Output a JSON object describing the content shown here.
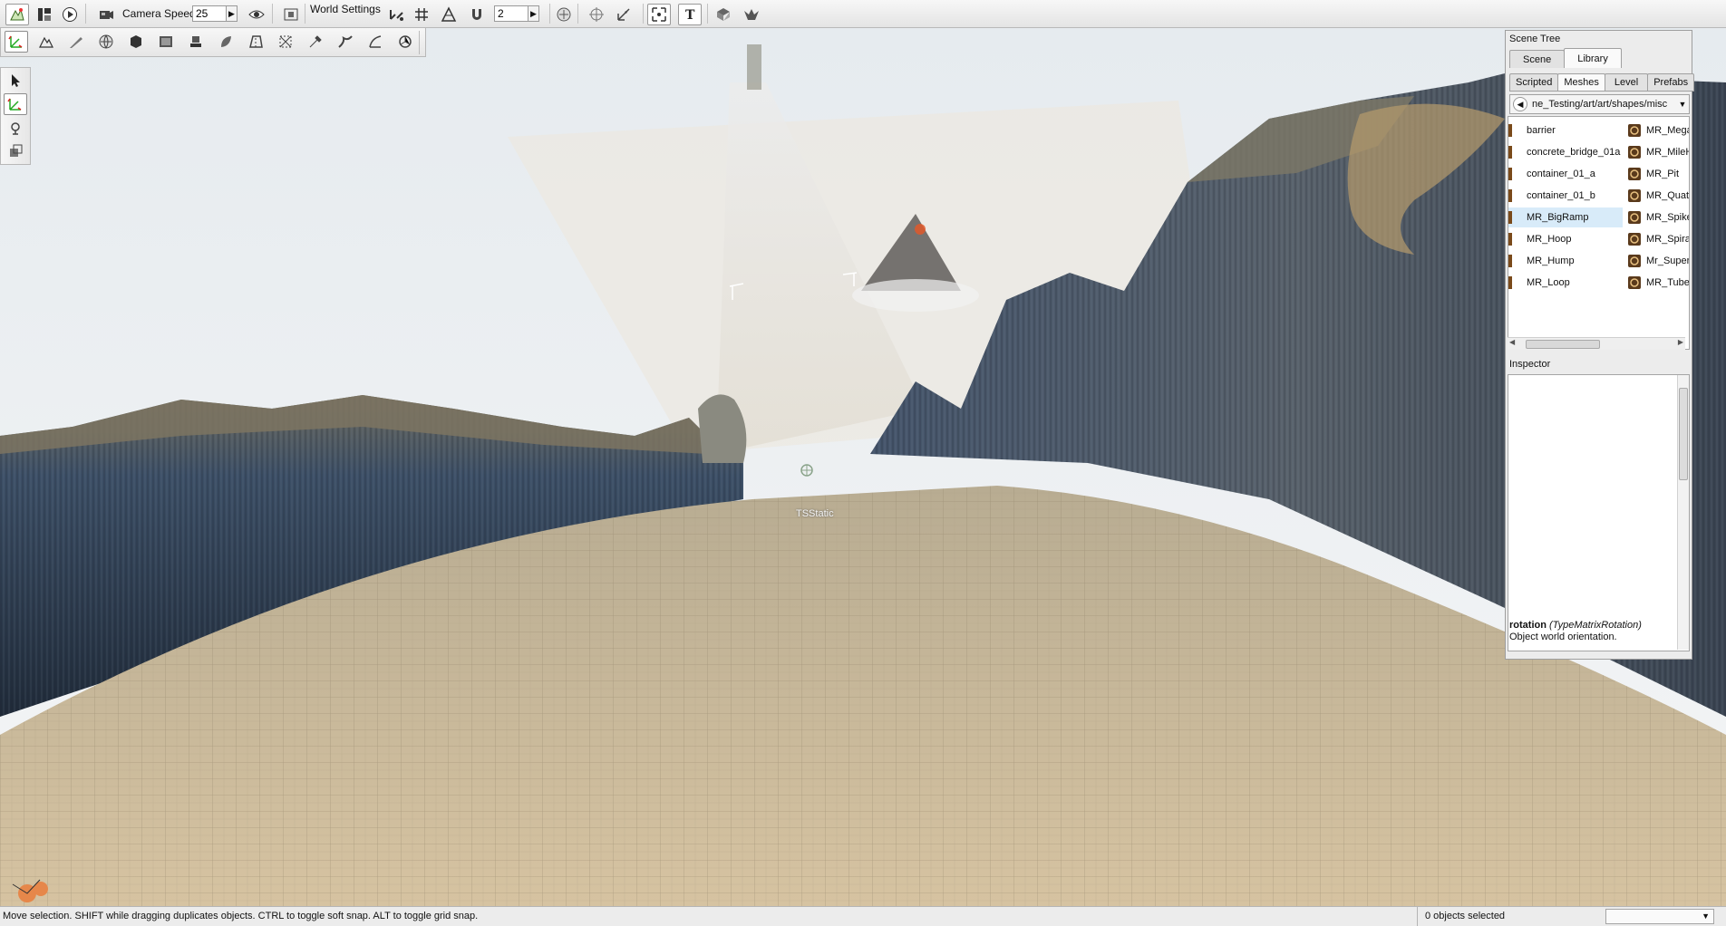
{
  "toolbar": {
    "camera_speed_label": "Camera Speed",
    "camera_speed_value": "25",
    "world_settings_label": "World Settings",
    "grid_snap_value": "2"
  },
  "viewport": {
    "object_label": "TSStatic"
  },
  "scene_tree": {
    "title": "Scene Tree",
    "tabs": [
      "Scene",
      "Library"
    ],
    "active_tab": "Library",
    "subtabs": [
      "Scripted",
      "Meshes",
      "Level",
      "Prefabs"
    ],
    "active_subtab": "Meshes",
    "path": "ne_Testing/art/art/shapes/misc",
    "assets_left": [
      "barrier",
      "concrete_bridge_01a",
      "container_01_a",
      "container_01_b",
      "MR_BigRamp",
      "MR_Hoop",
      "MR_Hump",
      "MR_Loop"
    ],
    "assets_right": [
      "MR_Mega",
      "MR_MileHi",
      "MR_Pit",
      "MR_Quate",
      "MR_Spike",
      "MR_Spiral",
      "Mr_Super",
      "MR_Tube"
    ],
    "selected_asset": "MR_BigRamp"
  },
  "inspector": {
    "title": "Inspector",
    "help_field": "rotation",
    "help_type": "(TypeMatrixRotation)",
    "help_text": "Object world orientation."
  },
  "status": {
    "message": "Move selection.  SHIFT while dragging duplicates objects.  CTRL to toggle soft snap.  ALT to toggle grid snap.",
    "selection": "0 objects selected"
  },
  "colors": {
    "accent": "#d8ebf9",
    "terrain_sand": "#c6b594",
    "rock_dark": "#3f4b5a",
    "sky": "#e8edf1"
  }
}
